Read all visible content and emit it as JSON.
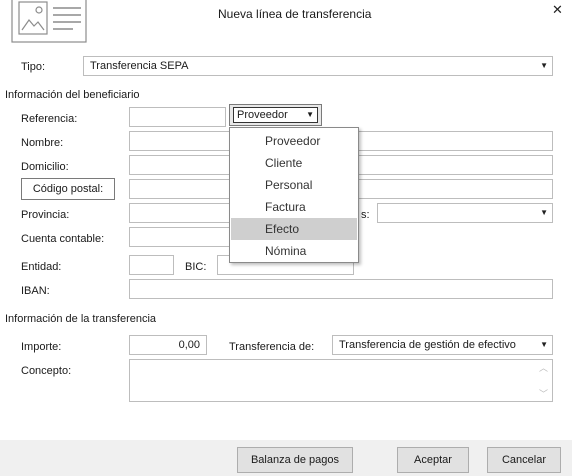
{
  "window": {
    "title": "Nueva línea de transferencia",
    "close_glyph": "✕"
  },
  "tipo": {
    "label": "Tipo:",
    "value": "Transferencia SEPA"
  },
  "beneficiario": {
    "section_title": "Información del beneficiario",
    "referencia_label": "Referencia:",
    "referencia_value": "",
    "tipo_selector_value": "Proveedor",
    "nombre_label": "Nombre:",
    "domicilio_label": "Domicilio:",
    "codigo_postal_button": "Código postal:",
    "provincia_label": "Provincia:",
    "pais_label_partial": "s:",
    "cuenta_contable_label": "Cuenta contable:",
    "entidad_label": "Entidad:",
    "bic_label": "BIC:",
    "iban_label": "IBAN:"
  },
  "dropdown": {
    "options": [
      "Proveedor",
      "Cliente",
      "Personal",
      "Factura",
      "Efecto",
      "Nómina"
    ],
    "highlighted": "Efecto"
  },
  "transferencia": {
    "section_title": "Información de la transferencia",
    "importe_label": "Importe:",
    "importe_value": "0,00",
    "transferencia_de_label": "Transferencia de:",
    "transferencia_de_value": "Transferencia de gestión de efectivo",
    "concepto_label": "Concepto:",
    "concepto_value": ""
  },
  "footer": {
    "balanza_button": "Balanza de pagos",
    "aceptar_button": "Aceptar",
    "cancelar_button": "Cancelar"
  },
  "colors": {
    "background": "#ffffff",
    "footer": "#f0f0f0",
    "highlight": "#cfcfcf",
    "border": "#bdbdbd"
  }
}
